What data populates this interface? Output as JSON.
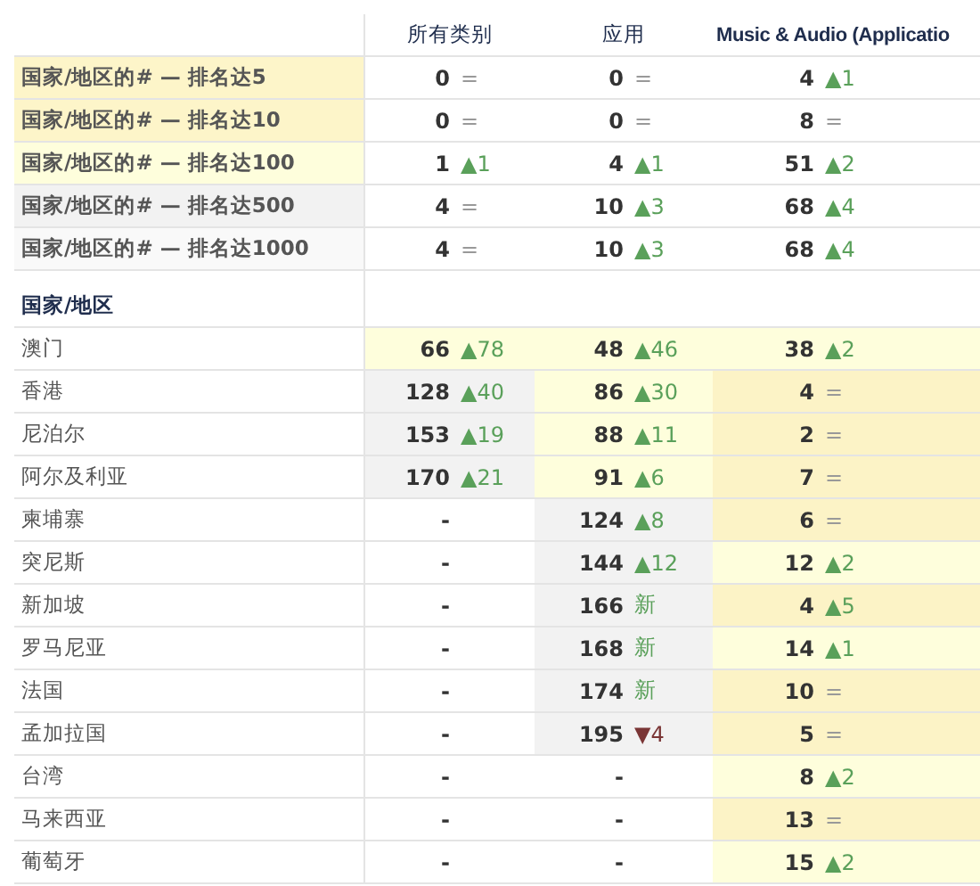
{
  "columns": [
    "所有类别",
    "应用",
    "Music & Audio (Applicatio"
  ],
  "summary_rows": [
    {
      "label": "国家/地区的# — 排名达5",
      "color": "#fdf5c9",
      "cells": [
        {
          "value": "0",
          "change": "=",
          "kind": "same"
        },
        {
          "value": "0",
          "change": "=",
          "kind": "same"
        },
        {
          "value": "4",
          "change": "▲1",
          "kind": "up"
        }
      ]
    },
    {
      "label": "国家/地区的# — 排名达10",
      "color": "#fdf5c9",
      "cells": [
        {
          "value": "0",
          "change": "=",
          "kind": "same"
        },
        {
          "value": "0",
          "change": "=",
          "kind": "same"
        },
        {
          "value": "8",
          "change": "=",
          "kind": "same"
        }
      ]
    },
    {
      "label": "国家/地区的# — 排名达100",
      "color": "#fefedc",
      "cells": [
        {
          "value": "1",
          "change": "▲1",
          "kind": "up"
        },
        {
          "value": "4",
          "change": "▲1",
          "kind": "up"
        },
        {
          "value": "51",
          "change": "▲2",
          "kind": "up"
        }
      ]
    },
    {
      "label": "国家/地区的# — 排名达500",
      "color": "#f2f2f2",
      "cells": [
        {
          "value": "4",
          "change": "=",
          "kind": "same"
        },
        {
          "value": "10",
          "change": "▲3",
          "kind": "up"
        },
        {
          "value": "68",
          "change": "▲4",
          "kind": "up"
        }
      ]
    },
    {
      "label": "国家/地区的# — 排名达1000",
      "color": "#f9f9f9",
      "cells": [
        {
          "value": "4",
          "change": "=",
          "kind": "same"
        },
        {
          "value": "10",
          "change": "▲3",
          "kind": "up"
        },
        {
          "value": "68",
          "change": "▲4",
          "kind": "up"
        }
      ]
    }
  ],
  "section_title": "国家/地区",
  "country_rows": [
    {
      "name": "澳门",
      "cells": [
        {
          "value": "66",
          "change": "▲78",
          "kind": "up",
          "color": "#fefedc"
        },
        {
          "value": "48",
          "change": "▲46",
          "kind": "up",
          "color": "#fefedc"
        },
        {
          "value": "38",
          "change": "▲2",
          "kind": "up",
          "color": "#fefedc"
        }
      ]
    },
    {
      "name": "香港",
      "cells": [
        {
          "value": "128",
          "change": "▲40",
          "kind": "up",
          "color": "#f2f2f2"
        },
        {
          "value": "86",
          "change": "▲30",
          "kind": "up",
          "color": "#fefedc"
        },
        {
          "value": "4",
          "change": "=",
          "kind": "same",
          "color": "#fcf3c6"
        }
      ]
    },
    {
      "name": "尼泊尔",
      "cells": [
        {
          "value": "153",
          "change": "▲19",
          "kind": "up",
          "color": "#f2f2f2"
        },
        {
          "value": "88",
          "change": "▲11",
          "kind": "up",
          "color": "#fefedc"
        },
        {
          "value": "2",
          "change": "=",
          "kind": "same",
          "color": "#fcf3c6"
        }
      ]
    },
    {
      "name": "阿尔及利亚",
      "cells": [
        {
          "value": "170",
          "change": "▲21",
          "kind": "up",
          "color": "#f2f2f2"
        },
        {
          "value": "91",
          "change": "▲6",
          "kind": "up",
          "color": "#fefedc"
        },
        {
          "value": "7",
          "change": "=",
          "kind": "same",
          "color": "#fcf3c6"
        }
      ]
    },
    {
      "name": "柬埔寨",
      "cells": [
        {
          "value": "-",
          "color": "#ffffff"
        },
        {
          "value": "124",
          "change": "▲8",
          "kind": "up",
          "color": "#f2f2f2"
        },
        {
          "value": "6",
          "change": "=",
          "kind": "same",
          "color": "#fcf3c6"
        }
      ]
    },
    {
      "name": "突尼斯",
      "cells": [
        {
          "value": "-",
          "color": "#ffffff"
        },
        {
          "value": "144",
          "change": "▲12",
          "kind": "up",
          "color": "#f2f2f2"
        },
        {
          "value": "12",
          "change": "▲2",
          "kind": "up",
          "color": "#fefedc"
        }
      ]
    },
    {
      "name": "新加坡",
      "cells": [
        {
          "value": "-",
          "color": "#ffffff"
        },
        {
          "value": "166",
          "change": "新",
          "kind": "new",
          "color": "#f2f2f2"
        },
        {
          "value": "4",
          "change": "▲5",
          "kind": "up",
          "color": "#fcf3c6"
        }
      ]
    },
    {
      "name": "罗马尼亚",
      "cells": [
        {
          "value": "-",
          "color": "#ffffff"
        },
        {
          "value": "168",
          "change": "新",
          "kind": "new",
          "color": "#f2f2f2"
        },
        {
          "value": "14",
          "change": "▲1",
          "kind": "up",
          "color": "#fefedc"
        }
      ]
    },
    {
      "name": "法国",
      "cells": [
        {
          "value": "-",
          "color": "#ffffff"
        },
        {
          "value": "174",
          "change": "新",
          "kind": "new",
          "color": "#f2f2f2"
        },
        {
          "value": "10",
          "change": "=",
          "kind": "same",
          "color": "#fcf3c6"
        }
      ]
    },
    {
      "name": "孟加拉国",
      "cells": [
        {
          "value": "-",
          "color": "#ffffff"
        },
        {
          "value": "195",
          "change": "▼4",
          "kind": "down",
          "color": "#f2f2f2"
        },
        {
          "value": "5",
          "change": "=",
          "kind": "same",
          "color": "#fcf3c6"
        }
      ]
    },
    {
      "name": "台湾",
      "cells": [
        {
          "value": "-",
          "color": "#ffffff"
        },
        {
          "value": "-",
          "color": "#ffffff"
        },
        {
          "value": "8",
          "change": "▲2",
          "kind": "up",
          "color": "#fefedc"
        }
      ]
    },
    {
      "name": "马来西亚",
      "cells": [
        {
          "value": "-",
          "color": "#ffffff"
        },
        {
          "value": "-",
          "color": "#ffffff"
        },
        {
          "value": "13",
          "change": "=",
          "kind": "same",
          "color": "#fcf3c6"
        }
      ]
    },
    {
      "name": "葡萄牙",
      "cells": [
        {
          "value": "-",
          "color": "#ffffff"
        },
        {
          "value": "-",
          "color": "#ffffff"
        },
        {
          "value": "15",
          "change": "▲2",
          "kind": "up",
          "color": "#fefedc"
        }
      ]
    }
  ]
}
